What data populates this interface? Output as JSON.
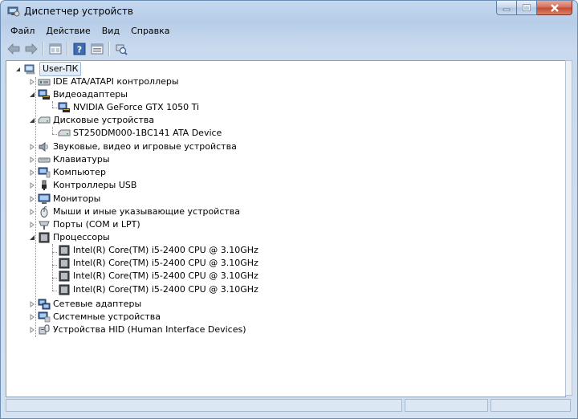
{
  "window": {
    "title": "Диспетчер устройств"
  },
  "menu": {
    "items": [
      "Файл",
      "Действие",
      "Вид",
      "Справка"
    ]
  },
  "toolbar": {
    "buttons": [
      "back-icon",
      "forward-icon",
      "properties-icon",
      "help-icon",
      "view-icon",
      "scan-hardware-icon"
    ]
  },
  "tree": {
    "root": "User-ПК",
    "nodes": [
      {
        "label": "IDE ATA/ATAPI контроллеры",
        "expanded": false,
        "children": []
      },
      {
        "label": "Видеоадаптеры",
        "expanded": true,
        "children": [
          "NVIDIA GeForce GTX 1050 Ti"
        ]
      },
      {
        "label": "Дисковые устройства",
        "expanded": true,
        "children": [
          "ST250DM000-1BC141 ATA Device"
        ]
      },
      {
        "label": "Звуковые, видео и игровые устройства",
        "expanded": false,
        "children": []
      },
      {
        "label": "Клавиатуры",
        "expanded": false,
        "children": []
      },
      {
        "label": "Компьютер",
        "expanded": false,
        "children": []
      },
      {
        "label": "Контроллеры USB",
        "expanded": false,
        "children": []
      },
      {
        "label": "Мониторы",
        "expanded": false,
        "children": []
      },
      {
        "label": "Мыши и иные указывающие устройства",
        "expanded": false,
        "children": []
      },
      {
        "label": "Порты (COM и LPT)",
        "expanded": false,
        "children": []
      },
      {
        "label": "Процессоры",
        "expanded": true,
        "children": [
          "Intel(R) Core(TM) i5-2400 CPU @ 3.10GHz",
          "Intel(R) Core(TM) i5-2400 CPU @ 3.10GHz",
          "Intel(R) Core(TM) i5-2400 CPU @ 3.10GHz",
          "Intel(R) Core(TM) i5-2400 CPU @ 3.10GHz"
        ]
      },
      {
        "label": "Сетевые адаптеры",
        "expanded": false,
        "children": []
      },
      {
        "label": "Системные устройства",
        "expanded": false,
        "children": []
      },
      {
        "label": "Устройства HID (Human Interface Devices)",
        "expanded": false,
        "children": []
      }
    ]
  },
  "colors": {
    "title_bar": "#c4d8ef",
    "close_button": "#c24a30",
    "selection_border": "#a0b7d3"
  }
}
